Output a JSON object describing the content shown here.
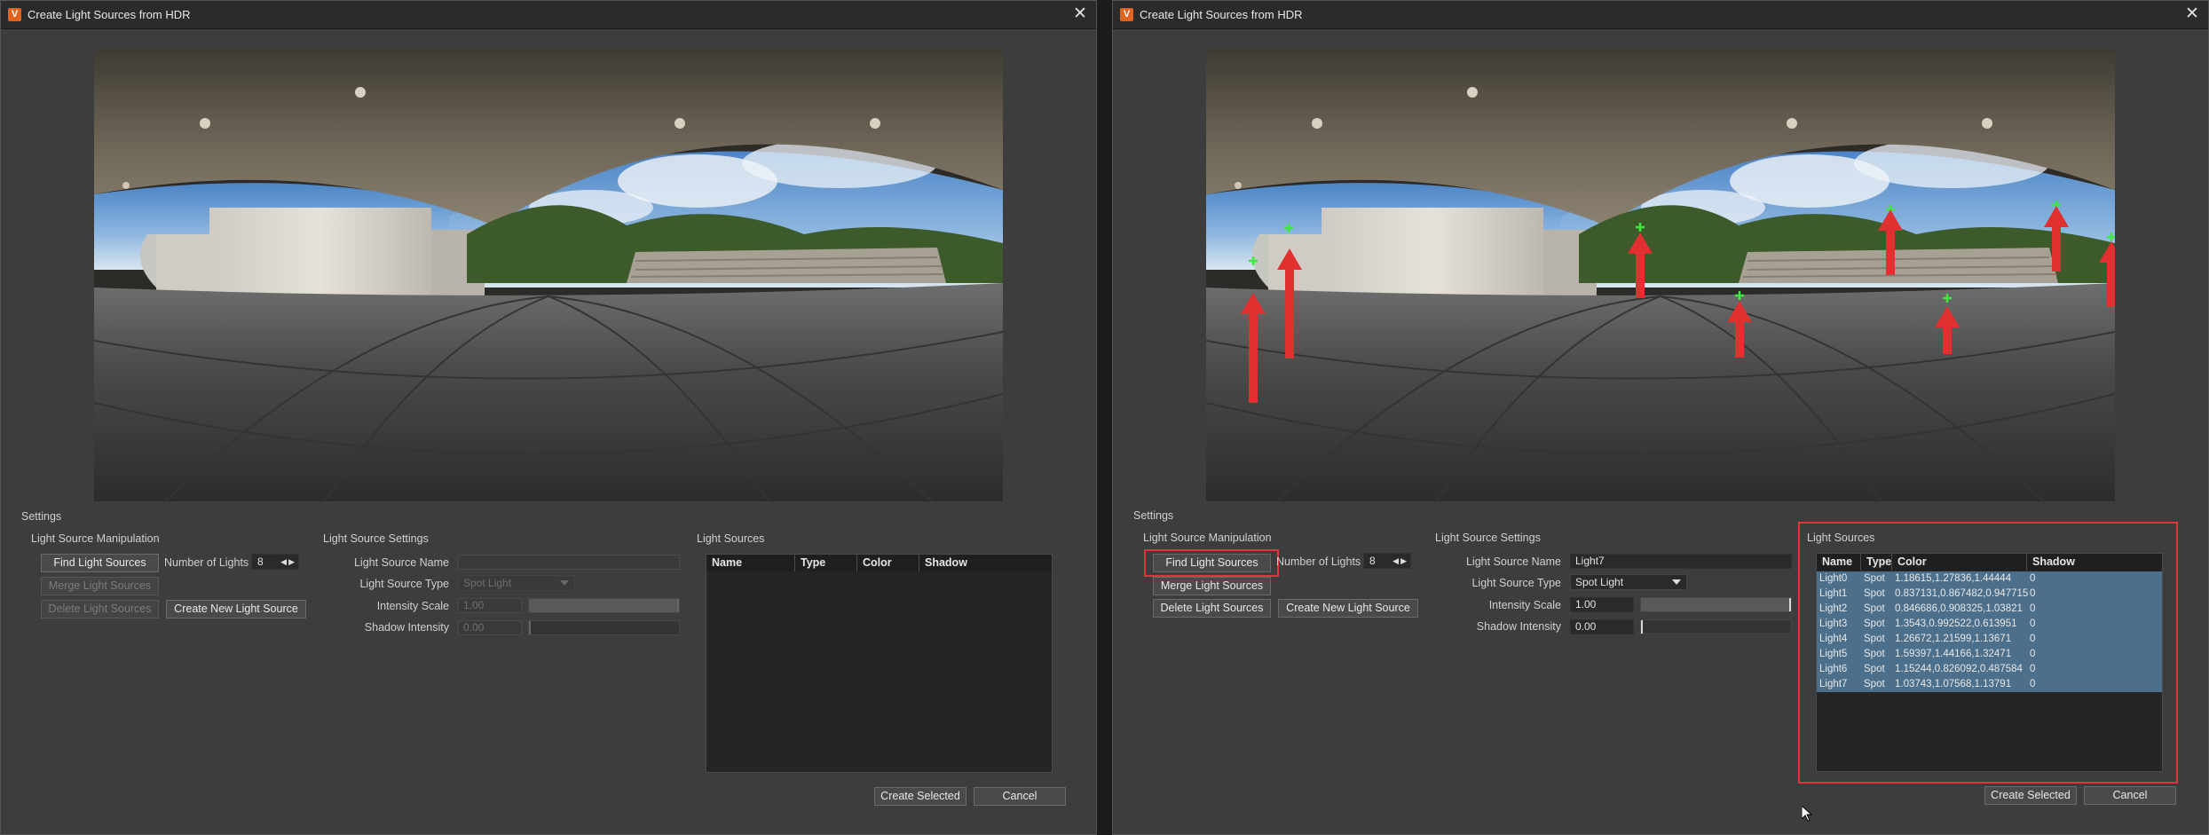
{
  "left_dialog": {
    "title": "Create Light Sources from HDR",
    "settings_label": "Settings",
    "manipulation": {
      "heading": "Light Source Manipulation",
      "find_label": "Find Light Sources",
      "merge_label": "Merge Light Sources",
      "delete_label": "Delete Light Sources",
      "create_new_label": "Create New Light Source",
      "number_label": "Number of Lights",
      "number_value": "8"
    },
    "source_settings": {
      "heading": "Light Source Settings",
      "name_label": "Light Source Name",
      "name_value": "",
      "type_label": "Light Source Type",
      "type_value": "Spot Light",
      "intensity_label": "Intensity Scale",
      "intensity_value": "1.00",
      "intensity_level": 1.0,
      "shadow_label": "Shadow Intensity",
      "shadow_value": "0.00",
      "shadow_level": 0.0
    },
    "light_sources": {
      "heading": "Light Sources",
      "columns": [
        "Name",
        "Type",
        "Color",
        "Shadow"
      ],
      "rows": []
    },
    "footer": {
      "create_selected_label": "Create Selected",
      "cancel_label": "Cancel"
    }
  },
  "right_dialog": {
    "title": "Create Light Sources from HDR",
    "settings_label": "Settings",
    "manipulation": {
      "heading": "Light Source Manipulation",
      "find_label": "Find Light Sources",
      "merge_label": "Merge Light Sources",
      "delete_label": "Delete Light Sources",
      "create_new_label": "Create New Light Source",
      "number_label": "Number of Lights",
      "number_value": "8"
    },
    "source_settings": {
      "heading": "Light Source Settings",
      "name_label": "Light Source Name",
      "name_value": "Light7",
      "type_label": "Light Source Type",
      "type_value": "Spot Light",
      "intensity_label": "Intensity Scale",
      "intensity_value": "1.00",
      "intensity_level": 1.0,
      "shadow_label": "Shadow Intensity",
      "shadow_value": "0.00",
      "shadow_level": 0.0
    },
    "light_sources": {
      "heading": "Light Sources",
      "columns": [
        "Name",
        "Type",
        "Color",
        "Shadow"
      ],
      "rows": [
        {
          "name": "Light0",
          "type": "Spot",
          "color": "1.18615,1.27836,1.44444",
          "shadow": "0"
        },
        {
          "name": "Light1",
          "type": "Spot",
          "color": "0.837131,0.867482,0.947715",
          "shadow": "0"
        },
        {
          "name": "Light2",
          "type": "Spot",
          "color": "0.846686,0.908325,1.03821",
          "shadow": "0"
        },
        {
          "name": "Light3",
          "type": "Spot",
          "color": "1.3543,0.992522,0.613951",
          "shadow": "0"
        },
        {
          "name": "Light4",
          "type": "Spot",
          "color": "1.26672,1.21599,1.13671",
          "shadow": "0"
        },
        {
          "name": "Light5",
          "type": "Spot",
          "color": "1.59397,1.44166,1.32471",
          "shadow": "0"
        },
        {
          "name": "Light6",
          "type": "Spot",
          "color": "1.15244,0.826092,0.487584",
          "shadow": "0"
        },
        {
          "name": "Light7",
          "type": "Spot",
          "color": "1.03743,1.07568,1.13791",
          "shadow": "0"
        }
      ]
    },
    "footer": {
      "create_selected_label": "Create Selected",
      "cancel_label": "Cancel"
    }
  },
  "colors": {
    "dialog_bg": "#3d3d3d",
    "titlebar_bg": "#2b2b2b",
    "selection_row": "#4c6f8b",
    "annotation_red": "#e1353b",
    "light_marker_green": "#3fe83f",
    "app_icon": "#e0631e"
  },
  "icons": [
    "app-icon",
    "close-icon",
    "spin-arrows-icon",
    "dropdown-arrow-icon",
    "mouse-cursor-icon",
    "annotation-arrow-icon",
    "light-marker-icon"
  ]
}
